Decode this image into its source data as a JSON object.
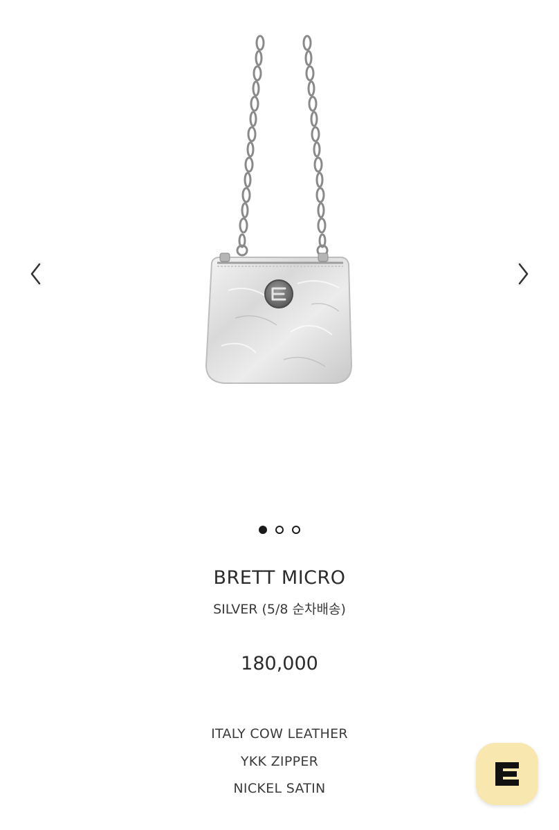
{
  "gallery": {
    "prev_icon": "chevron-left-icon",
    "next_icon": "chevron-right-icon",
    "slide_count": 3,
    "active_slide": 1
  },
  "product": {
    "title": "BRETT MICRO",
    "subtitle": "SILVER (5/8 순차배송)",
    "price": "180,000",
    "specs": [
      "ITALY COW LEATHER",
      "YKK ZIPPER",
      "NICKEL SATIN"
    ]
  },
  "brand_button": {
    "icon": "brand-logo-icon",
    "color": "#f9e7b0"
  },
  "colors": {
    "text": "#2b2b2b",
    "dot_active": "#1a1a1a",
    "background": "#ffffff"
  }
}
